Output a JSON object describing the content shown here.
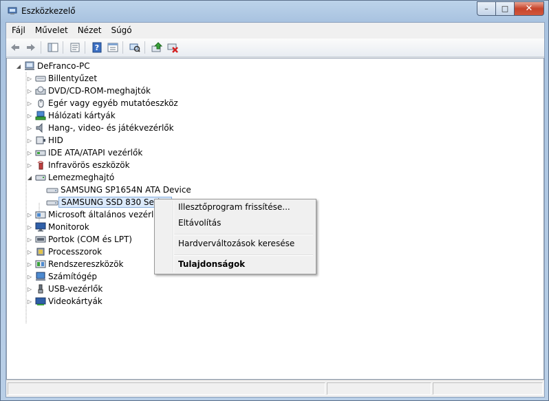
{
  "window": {
    "title": "Eszközkezelő"
  },
  "caption_buttons": {
    "minimize": "–",
    "maximize": "□",
    "close": "✕"
  },
  "menubar": {
    "items": [
      "Fájl",
      "Művelet",
      "Nézet",
      "Súgó"
    ]
  },
  "toolbar": {
    "icons": [
      "back-arrow-icon",
      "forward-arrow-icon",
      "show-hide-console-tree-icon",
      "properties-icon",
      "help-icon",
      "view-icon",
      "scan-hardware-icon",
      "update-driver-icon",
      "uninstall-icon"
    ]
  },
  "tree": {
    "root": "DeFranco-PC",
    "items": [
      {
        "label": "Billentyűzet",
        "icon": "keyboard-icon"
      },
      {
        "label": "DVD/CD-ROM-meghajtók",
        "icon": "dvd-drive-icon"
      },
      {
        "label": "Egér vagy egyéb mutatóeszköz",
        "icon": "mouse-icon"
      },
      {
        "label": "Hálózati kártyák",
        "icon": "network-icon"
      },
      {
        "label": "Hang-, video- és játékvezérlők",
        "icon": "speaker-icon"
      },
      {
        "label": "HID",
        "icon": "hid-icon"
      },
      {
        "label": "IDE ATA/ATAPI vezérlők",
        "icon": "ide-controller-icon"
      },
      {
        "label": "Infravörös eszközök",
        "icon": "infrared-icon"
      },
      {
        "label": "Lemezmeghajtó",
        "icon": "disk-drive-icon",
        "expanded": true,
        "children": [
          {
            "label": "SAMSUNG SP1654N ATA Device",
            "icon": "hard-disk-icon"
          },
          {
            "label": "SAMSUNG SSD 830 Series",
            "icon": "hard-disk-icon",
            "selected": true
          }
        ]
      },
      {
        "label": "Microsoft általános vezérlő W",
        "icon": "controller-icon"
      },
      {
        "label": "Monitorok",
        "icon": "monitor-icon"
      },
      {
        "label": "Portok (COM és LPT)",
        "icon": "port-icon"
      },
      {
        "label": "Processzorok",
        "icon": "processor-icon"
      },
      {
        "label": "Rendszereszközök",
        "icon": "system-device-icon"
      },
      {
        "label": "Számítógép",
        "icon": "computer-icon"
      },
      {
        "label": "USB-vezérlők",
        "icon": "usb-icon"
      },
      {
        "label": "Videokártyák",
        "icon": "display-adapter-icon"
      }
    ]
  },
  "context_menu": {
    "items": [
      {
        "label": "Illesztőprogram frissítése...",
        "bold": false
      },
      {
        "label": "Eltávolítás",
        "bold": false
      },
      {
        "separator": true
      },
      {
        "label": "Hardverváltozások keresése",
        "bold": false
      },
      {
        "separator": true
      },
      {
        "label": "Tulajdonságok",
        "bold": true
      }
    ]
  },
  "colors": {
    "selection_bg": "#dceafb",
    "selection_border": "#84acdd",
    "title_gradient_top": "#bcd3ea",
    "close_red": "#c7442b"
  }
}
